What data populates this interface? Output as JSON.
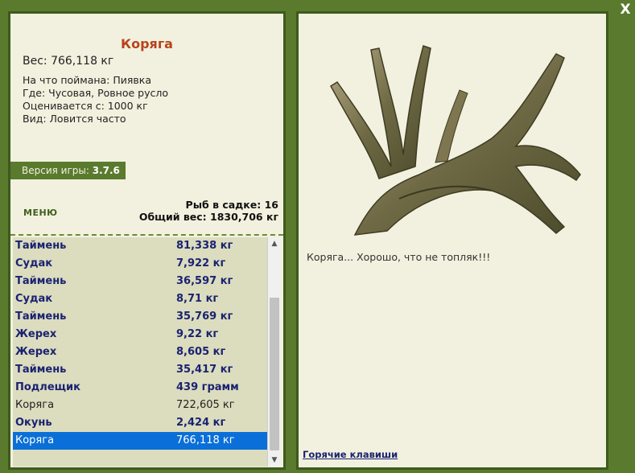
{
  "close_label": "X",
  "fish": {
    "title": "Коряга",
    "weight": "Вес: 766,118 кг",
    "caught_with": "На что поймана: Пиявка",
    "location": "Где: Чусовая, Ровное русло",
    "valued_from": "Оценивается с: 1000 кг",
    "frequency": "Вид: Ловится часто"
  },
  "version": {
    "label": "Версия игры:",
    "value": "3.7.6"
  },
  "menu_label": "МЕНЮ",
  "stats": {
    "fish_count": "Рыб в садке: 16",
    "total_weight": "Общий вес: 1830,706 кг"
  },
  "catch_list": [
    {
      "name": "Таймень",
      "weight": "81,338 кг"
    },
    {
      "name": "Судак",
      "weight": "7,922 кг"
    },
    {
      "name": "Таймень",
      "weight": "36,597 кг"
    },
    {
      "name": "Судак",
      "weight": "8,71 кг"
    },
    {
      "name": "Таймень",
      "weight": "35,769 кг"
    },
    {
      "name": "Жерех",
      "weight": "9,22 кг"
    },
    {
      "name": "Жерех",
      "weight": "8,605 кг"
    },
    {
      "name": "Таймень",
      "weight": "35,417 кг"
    },
    {
      "name": "Подлещик",
      "weight": "439 грамм"
    },
    {
      "name": "Коряга",
      "weight": "722,605 кг"
    },
    {
      "name": "Окунь",
      "weight": "2,424 кг"
    },
    {
      "name": "Коряга",
      "weight": "766,118 кг"
    }
  ],
  "comment": "Коряга... Хорошо, что не топляк!!!",
  "hotkeys_label": "Горячие клавиши",
  "colors": {
    "bg": "#5a7a2e",
    "panel": "#f2f1df",
    "accent_title": "#b8431b",
    "selected": "#0a6fd8"
  }
}
